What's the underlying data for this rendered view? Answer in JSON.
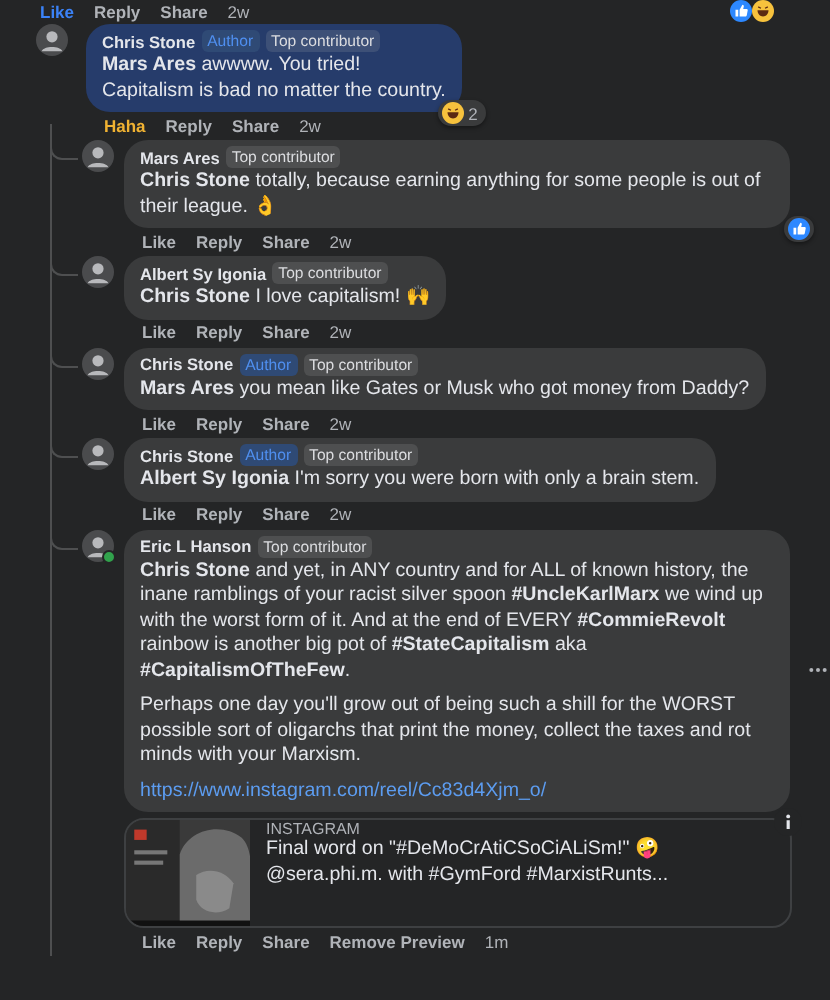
{
  "top_actions": {
    "like_button": {
      "label": "Like",
      "selected": true
    },
    "actions": [
      "Reply",
      "Share"
    ],
    "time": "2w",
    "reactions": [
      {
        "kind": "like"
      },
      {
        "kind": "haha"
      }
    ]
  },
  "comments": [
    {
      "author": "Chris Stone",
      "badges": [
        {
          "label": "Author",
          "kind": "author"
        },
        {
          "label": "Top contributor",
          "kind": "contributor"
        }
      ],
      "highlighted": true,
      "paragraphs": [
        "**Mars Ares** awwww. You tried!",
        "Capitalism is bad no matter the country."
      ],
      "reactions": {
        "kinds": [
          {
            "kind": "haha"
          }
        ],
        "count": "2"
      },
      "like_button": {
        "label": "Haha",
        "kind": "haha",
        "selected": true
      },
      "actions": [
        "Reply",
        "Share"
      ],
      "time": "2w",
      "children": [
        {
          "author": "Mars Ares",
          "badges": [
            {
              "label": "Top contributor",
              "kind": "contributor"
            }
          ],
          "highlighted": false,
          "paragraphs": [
            "**Chris Stone** totally, because earning anything for some people is out of their league. 👌"
          ],
          "reactions": {
            "kinds": [
              {
                "kind": "like"
              }
            ]
          },
          "like_button": {
            "label": "Like",
            "selected": false
          },
          "actions": [
            "Reply",
            "Share"
          ],
          "time": "2w"
        },
        {
          "author": "Albert Sy Igonia",
          "badges": [
            {
              "label": "Top contributor",
              "kind": "contributor"
            }
          ],
          "highlighted": false,
          "paragraphs": [
            "**Chris Stone** I love capitalism! 🙌"
          ],
          "like_button": {
            "label": "Like",
            "selected": false
          },
          "actions": [
            "Reply",
            "Share"
          ],
          "time": "2w"
        },
        {
          "author": "Chris Stone",
          "badges": [
            {
              "label": "Author",
              "kind": "author"
            },
            {
              "label": "Top contributor",
              "kind": "contributor"
            }
          ],
          "highlighted": false,
          "paragraphs": [
            "**Mars Ares** you mean like Gates or Musk who got money from Daddy?"
          ],
          "like_button": {
            "label": "Like",
            "selected": false
          },
          "actions": [
            "Reply",
            "Share"
          ],
          "time": "2w"
        },
        {
          "author": "Chris Stone",
          "badges": [
            {
              "label": "Author",
              "kind": "author"
            },
            {
              "label": "Top contributor",
              "kind": "contributor"
            }
          ],
          "highlighted": false,
          "paragraphs": [
            "**Albert Sy Igonia** I'm sorry you were born with only a brain stem."
          ],
          "like_button": {
            "label": "Like",
            "selected": false
          },
          "actions": [
            "Reply",
            "Share"
          ],
          "time": "2w"
        },
        {
          "author": "Eric L Hanson",
          "online": true,
          "badges": [
            {
              "label": "Top contributor",
              "kind": "contributor"
            }
          ],
          "highlighted": false,
          "paragraphs": [
            "**Chris Stone** and yet, in ANY country and for ALL of known history, the inane ramblings of your racist silver spoon **#UncleKarlMarx** we wind up with the worst form of it. And at the end of EVERY **#CommieRevolt** rainbow is another big pot of **#StateCapitalism** aka **#CapitalismOfTheFew**.",
            "Perhaps one day you'll grow out of being such a shill for the WORST possible sort of oligarchs that print the money, collect the taxes and rot minds with your Marxism."
          ],
          "link": "https://www.instagram.com/reel/Cc83d4Xjm_o/",
          "more": true,
          "preview": {
            "site": "INSTAGRAM",
            "title": "Final word on \"#DeMoCrAtiCSoCiALiSm!\" 🤪",
            "description": "@sera.phi.m. with #GymFord #MarxistRunts..."
          },
          "like_button": {
            "label": "Like",
            "selected": false
          },
          "actions": [
            "Reply",
            "Share",
            "Remove Preview"
          ],
          "time": "1m"
        }
      ]
    }
  ]
}
